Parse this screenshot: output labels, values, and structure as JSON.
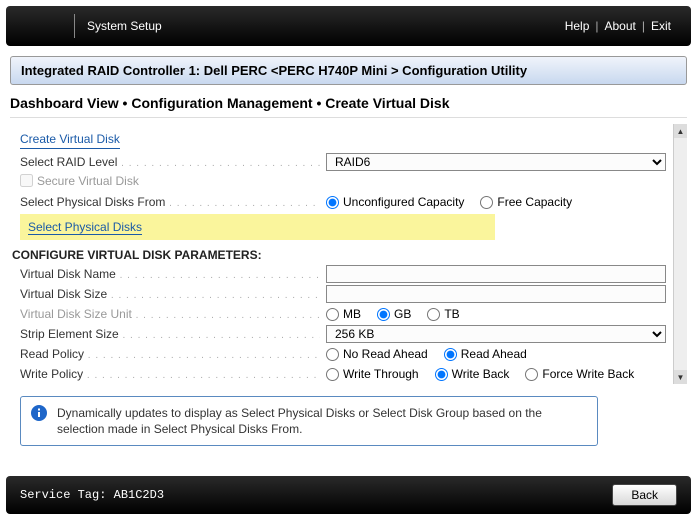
{
  "topbar": {
    "title": "System Setup",
    "help": "Help",
    "about": "About",
    "exit": "Exit"
  },
  "page_title": "Integrated RAID Controller 1: Dell PERC <PERC H740P Mini > Configuration Utility",
  "breadcrumb": "Dashboard View • Configuration Management • Create Virtual Disk",
  "form": {
    "create_vd_link": "Create Virtual Disk",
    "raid_level_label": "Select RAID Level",
    "raid_level_value": "RAID6",
    "secure_vd_label": "Secure Virtual Disk",
    "phys_from_label": "Select Physical Disks From",
    "phys_from_options": {
      "unconfigured": "Unconfigured Capacity",
      "free": "Free Capacity"
    },
    "phys_from_selected": "unconfigured",
    "select_phys_link": "Select Physical Disks",
    "params_header": "CONFIGURE VIRTUAL DISK PARAMETERS:",
    "vd_name_label": "Virtual Disk Name",
    "vd_name_value": "",
    "vd_size_label": "Virtual Disk Size",
    "vd_size_value": "",
    "vd_size_unit_label": "Virtual Disk Size Unit",
    "vd_size_unit_options": {
      "mb": "MB",
      "gb": "GB",
      "tb": "TB"
    },
    "vd_size_unit_selected": "gb",
    "strip_label": "Strip Element Size",
    "strip_value": "256 KB",
    "read_policy_label": "Read Policy",
    "read_policy_options": {
      "nra": "No Read Ahead",
      "ra": "Read Ahead"
    },
    "read_policy_selected": "ra",
    "write_policy_label": "Write Policy",
    "write_policy_options": {
      "wt": "Write Through",
      "wb": "Write Back",
      "fwb": "Force Write Back"
    },
    "write_policy_selected": "wb"
  },
  "info_text": "Dynamically updates to display as Select Physical Disks or Select Disk Group based on the selection made in Select Physical Disks From.",
  "bottom": {
    "service_tag_label": "Service Tag:",
    "service_tag_value": "AB1C2D3",
    "back": "Back"
  }
}
